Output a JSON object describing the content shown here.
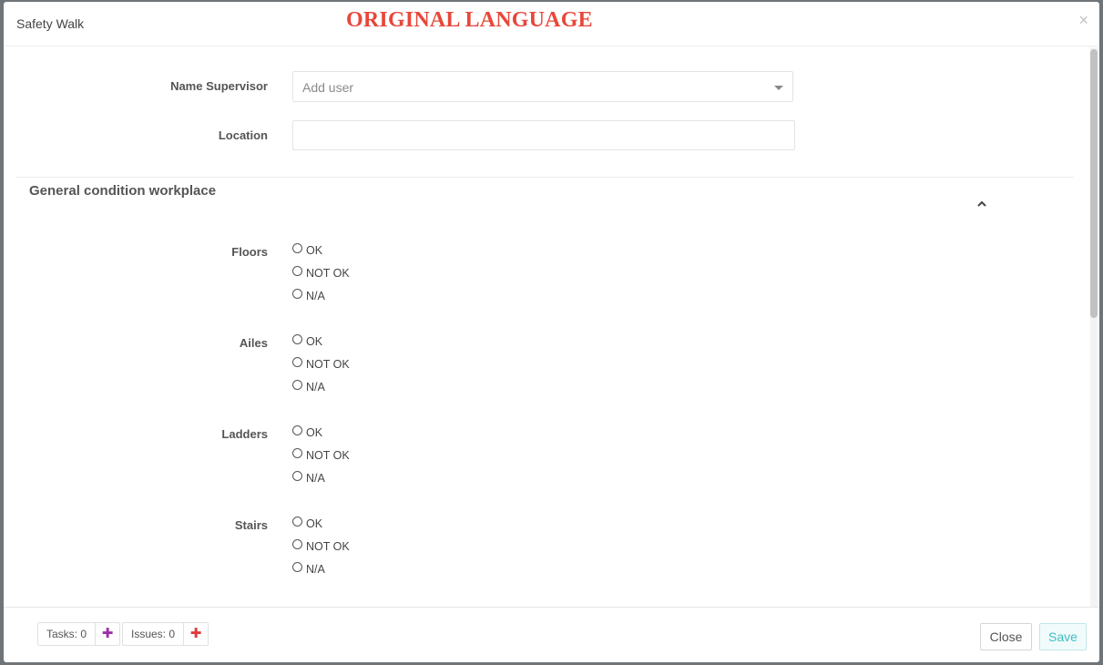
{
  "header": {
    "title": "Safety Walk",
    "banner": "ORIGINAL LANGUAGE",
    "close_symbol": "×"
  },
  "form": {
    "supervisor": {
      "label": "Name Supervisor",
      "placeholder": "Add user"
    },
    "location": {
      "label": "Location",
      "value": ""
    }
  },
  "section": {
    "title": "General condition workplace",
    "questions": [
      {
        "label": "Floors",
        "options": [
          "OK",
          "NOT OK",
          "N/A"
        ]
      },
      {
        "label": "Ailes",
        "options": [
          "OK",
          "NOT OK",
          "N/A"
        ]
      },
      {
        "label": "Ladders",
        "options": [
          "OK",
          "NOT OK",
          "N/A"
        ]
      },
      {
        "label": "Stairs",
        "options": [
          "OK",
          "NOT OK",
          "N/A"
        ]
      }
    ]
  },
  "footer": {
    "tasks_label": "Tasks: 0",
    "issues_label": "Issues: 0",
    "add_symbol": "✚",
    "close_label": "Close",
    "save_label": "Save"
  },
  "colors": {
    "banner": "#e8473a",
    "tasks_add": "#9b30a8",
    "issues_add": "#e03a3a",
    "save": "#3bbfc3"
  },
  "icons": {
    "close": "close-icon",
    "dropdown": "chevron-down-icon",
    "collapse": "chevron-up-icon",
    "add": "plus-icon"
  }
}
